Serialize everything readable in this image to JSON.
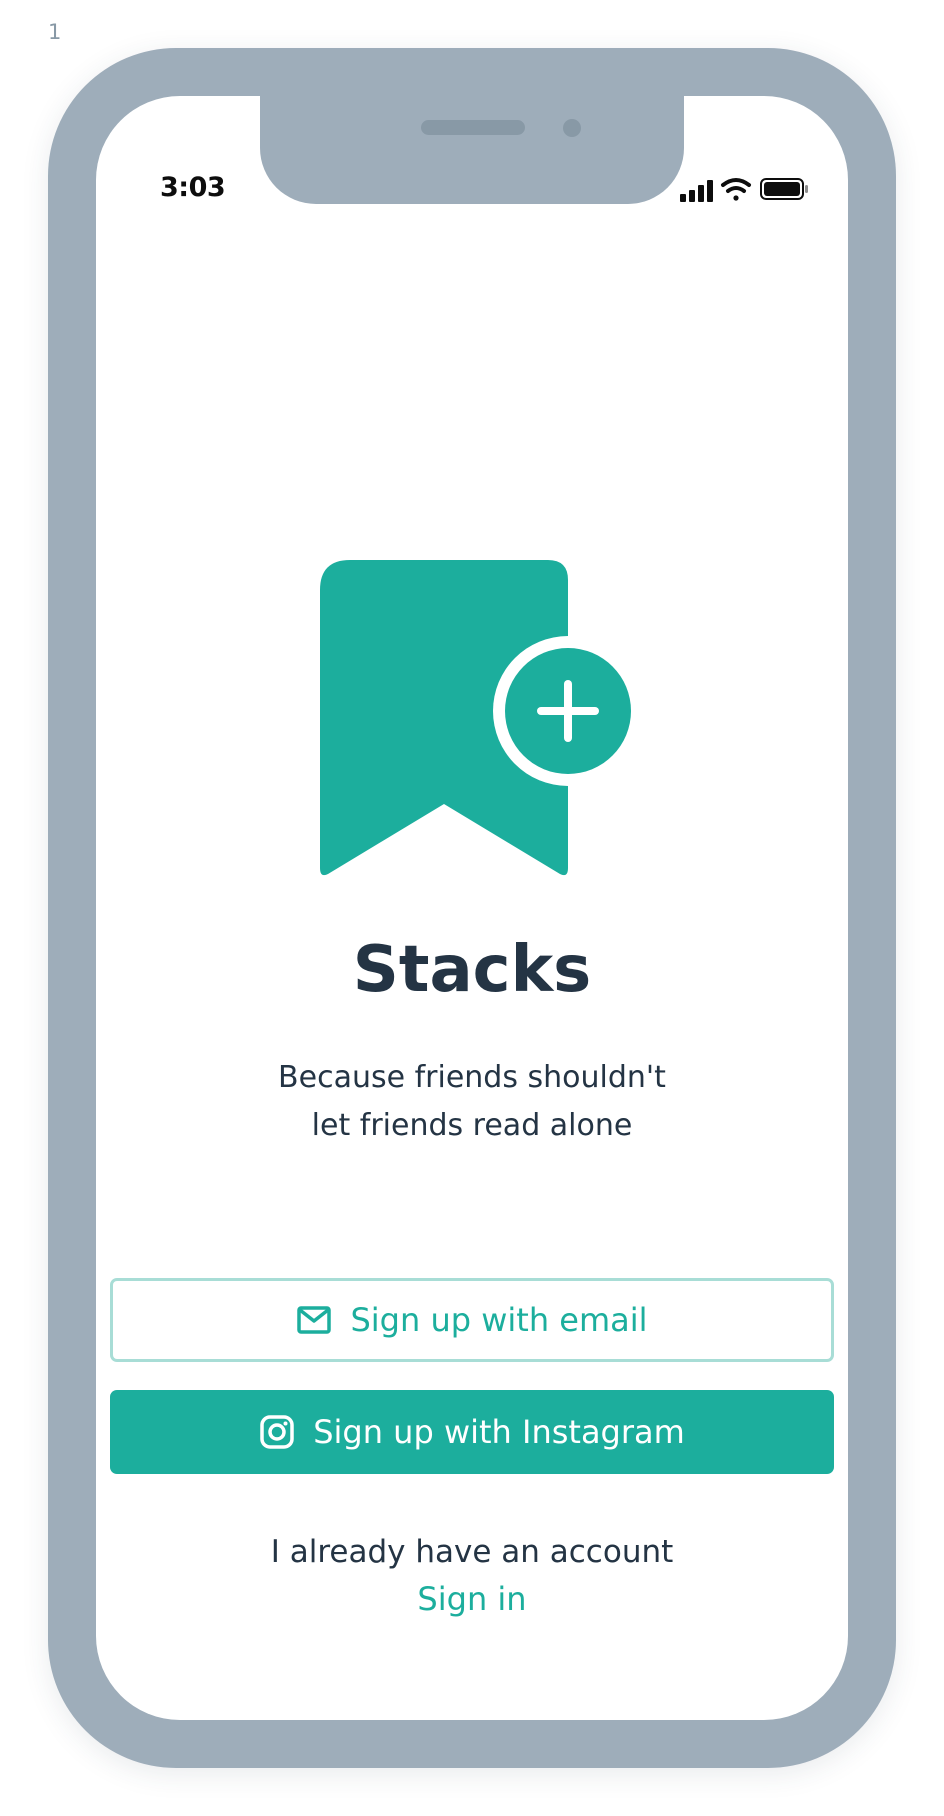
{
  "frame": {
    "number": "1"
  },
  "status_bar": {
    "time": "3:03",
    "icons": [
      "signal-icon",
      "wifi-icon",
      "battery-icon"
    ]
  },
  "app": {
    "title": "Stacks",
    "tagline_line1": "Because friends shouldn't",
    "tagline_line2": "let friends read alone",
    "logo_icon": "bookmark-plus-icon"
  },
  "actions": {
    "email_label": "Sign up with email",
    "email_icon": "mail-icon",
    "instagram_label": "Sign up with Instagram",
    "instagram_icon": "instagram-icon",
    "account_text": "I already have an account",
    "signin_label": "Sign in"
  },
  "colors": {
    "accent": "#1cae9d",
    "accent_light": "#a8ddd6",
    "text_dark": "#243444",
    "device_frame": "#9eadba",
    "screen": "#ffffff"
  }
}
